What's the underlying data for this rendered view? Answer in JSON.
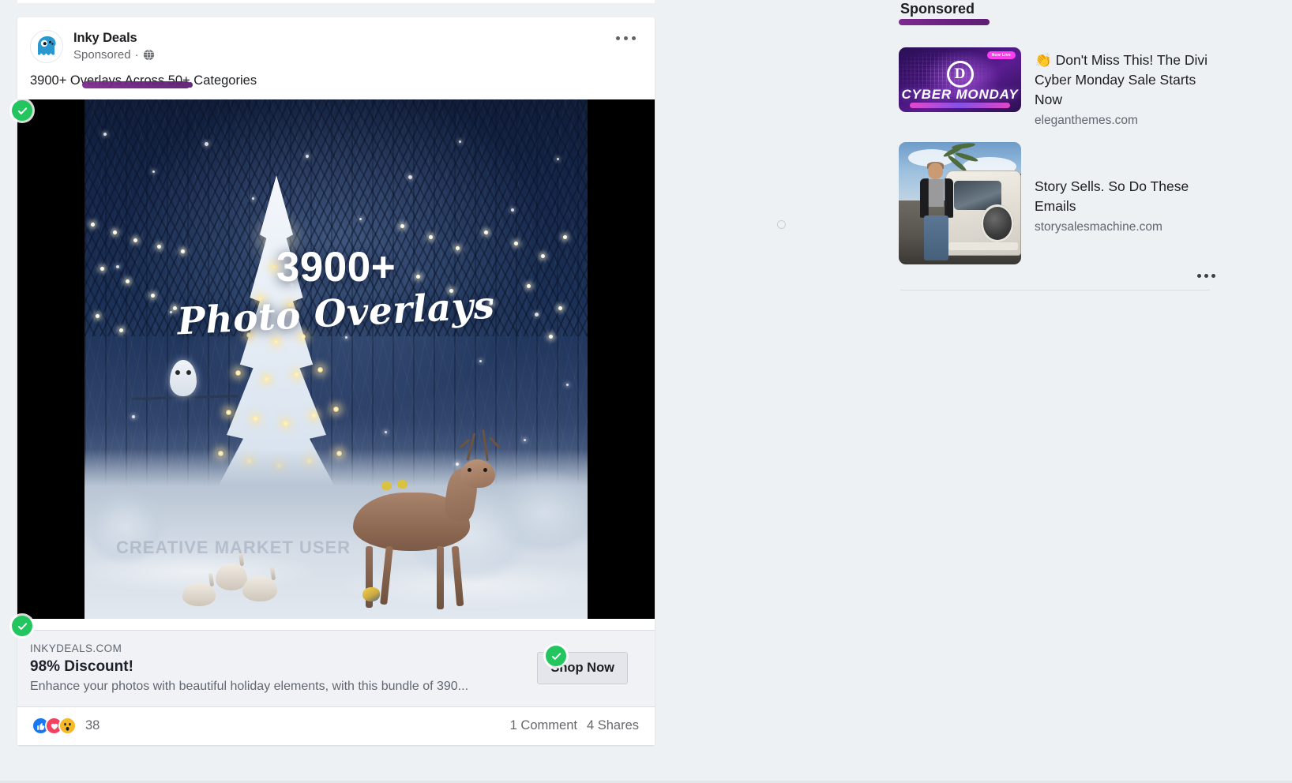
{
  "post": {
    "page_name": "Inky Deals",
    "sponsored_label": "Sponsored",
    "separator": "·",
    "audience_icon": "globe-icon",
    "menu_icon": "ellipsis-icon",
    "body_text": "3900+ Overlays Across 50+ Categories",
    "ad_image": {
      "headline_number": "3900+",
      "headline_script": "Photo Overlays",
      "watermark": "CREATIVE MARKET USER",
      "scene": "snowy-forest-christmas-tree-deer"
    },
    "link_card": {
      "domain": "INKYDEALS.COM",
      "title": "98% Discount!",
      "description": "Enhance your photos with beautiful holiday elements, with this bundle of 390...",
      "cta_label": "Shop Now"
    },
    "reactions": {
      "icons": [
        "like-icon",
        "love-icon",
        "wow-icon"
      ],
      "like_glyph": "👍",
      "love_glyph": "♥",
      "wow_glyph": "😮",
      "count": "38",
      "comments": "1 Comment",
      "shares": "4 Shares"
    }
  },
  "sidebar": {
    "heading": "Sponsored",
    "ads": [
      {
        "emoji": "👏",
        "title": "Don't Miss This! The Divi Cyber Monday Sale Starts Now",
        "domain": "eleganthemes.com",
        "thumb": {
          "type": "divi-cyber-monday-banner",
          "logo_letter": "D",
          "banner_title": "CYBER MONDAY",
          "badge": "Now Live"
        }
      },
      {
        "emoji": "",
        "title": "Story Sells. So Do These Emails",
        "domain": "storysalesmachine.com",
        "thumb": {
          "type": "man-with-vw-van-photo"
        }
      }
    ],
    "menu_icon": "ellipsis-icon"
  },
  "annotations": {
    "marker_color": "#6b2180",
    "check_badge_color": "#22c55e",
    "check_glyph": "✓",
    "badges": [
      "image-top-check",
      "image-bottom-check",
      "cta-check"
    ]
  },
  "colors": {
    "page_background": "#eef1f4",
    "card_background": "#ffffff",
    "link_card_background": "#f0f2f5",
    "text_primary": "#1c1e21",
    "text_secondary": "#65676b",
    "accent_like": "#1877f2",
    "accent_love": "#f3425f",
    "accent_wow": "#f7b928"
  }
}
